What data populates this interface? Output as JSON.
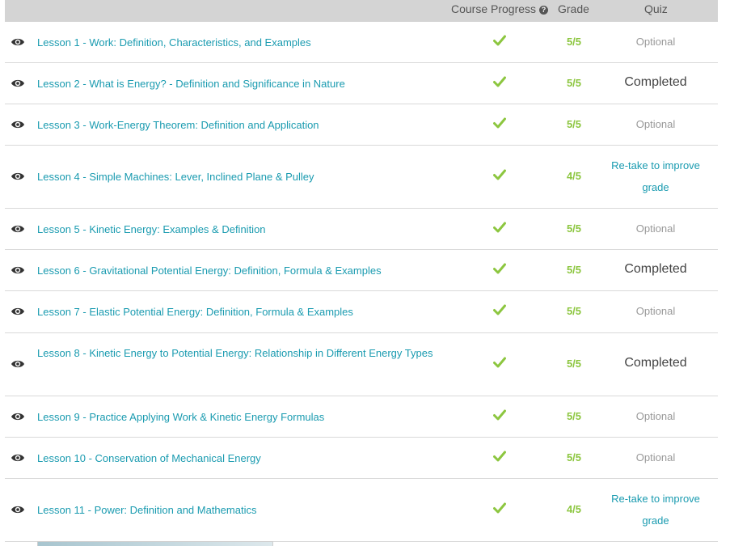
{
  "header": {
    "course_progress": "Course Progress",
    "help_icon": "question-circle-icon",
    "grade": "Grade",
    "quiz": "Quiz"
  },
  "colors": {
    "link": "#1a9bb0",
    "grade": "#8cc63f",
    "header_bg": "#d4d4d4"
  },
  "lessons": [
    {
      "title": "Lesson 1 - Work: Definition, Characteristics, and Examples",
      "grade": "5/5",
      "quiz": "Optional",
      "quiz_state": "optional"
    },
    {
      "title": "Lesson 2 - What is Energy? - Definition and Significance in Nature",
      "grade": "5/5",
      "quiz": "Completed",
      "quiz_state": "completed"
    },
    {
      "title": "Lesson 3 - Work-Energy Theorem: Definition and Application",
      "grade": "5/5",
      "quiz": "Optional",
      "quiz_state": "optional"
    },
    {
      "title": "Lesson 4 - Simple Machines: Lever, Inclined Plane & Pulley",
      "grade": "4/5",
      "quiz": "Re-take to improve grade",
      "quiz_state": "retake"
    },
    {
      "title": "Lesson 5 - Kinetic Energy: Examples & Definition",
      "grade": "5/5",
      "quiz": "Optional",
      "quiz_state": "optional"
    },
    {
      "title": "Lesson 6 - Gravitational Potential Energy: Definition, Formula & Examples",
      "grade": "5/5",
      "quiz": "Completed",
      "quiz_state": "completed"
    },
    {
      "title": "Lesson 7 - Elastic Potential Energy: Definition, Formula & Examples",
      "grade": "5/5",
      "quiz": "Optional",
      "quiz_state": "optional"
    },
    {
      "title": "Lesson 8 - Kinetic Energy to Potential Energy: Relationship in Different Energy Types",
      "grade": "5/5",
      "quiz": "Completed",
      "quiz_state": "completed"
    },
    {
      "title": "Lesson 9 - Practice Applying Work & Kinetic Energy Formulas",
      "grade": "5/5",
      "quiz": "Optional",
      "quiz_state": "optional"
    },
    {
      "title": "Lesson 10 - Conservation of Mechanical Energy",
      "grade": "5/5",
      "quiz": "Optional",
      "quiz_state": "optional"
    },
    {
      "title": "Lesson 11 - Power: Definition and Mathematics",
      "grade": "4/5",
      "quiz": "Re-take to improve grade",
      "quiz_state": "retake"
    }
  ]
}
